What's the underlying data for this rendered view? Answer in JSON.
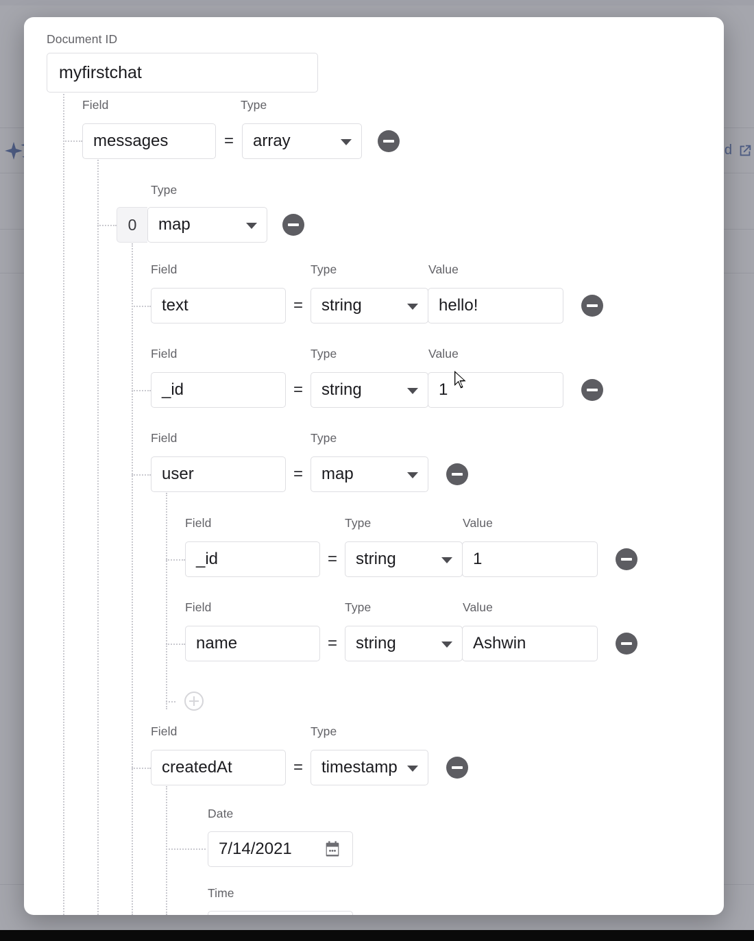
{
  "background": {
    "sparkle_icon": "sparkle-icon",
    "link_text": "ed",
    "external_link_icon": "external-link-icon",
    "accent_color": "#1b3f94"
  },
  "dialog": {
    "document_id": {
      "label": "Document ID",
      "value": "myfirstchat"
    },
    "column_labels": {
      "field": "Field",
      "type": "Type",
      "value": "Value",
      "date": "Date",
      "time": "Time"
    },
    "symbols": {
      "equals": "=",
      "remove_icon": "minus-circle-icon",
      "add_icon": "plus-circle-icon",
      "dropdown_icon": "chevron-down-icon",
      "calendar_icon": "calendar-icon"
    },
    "rows": {
      "messages": {
        "field": "messages",
        "type": "array"
      },
      "index0": {
        "index": "0",
        "type": "map"
      },
      "text": {
        "field": "text",
        "type": "string",
        "value": "hello!"
      },
      "msg_id": {
        "field": "_id",
        "type": "string",
        "value": "1"
      },
      "user": {
        "field": "user",
        "type": "map"
      },
      "user_id": {
        "field": "_id",
        "type": "string",
        "value": "1"
      },
      "user_name": {
        "field": "name",
        "type": "string",
        "value": "Ashwin"
      },
      "createdAt": {
        "field": "createdAt",
        "type": "timestamp"
      },
      "date": {
        "value": "7/14/2021"
      }
    }
  }
}
